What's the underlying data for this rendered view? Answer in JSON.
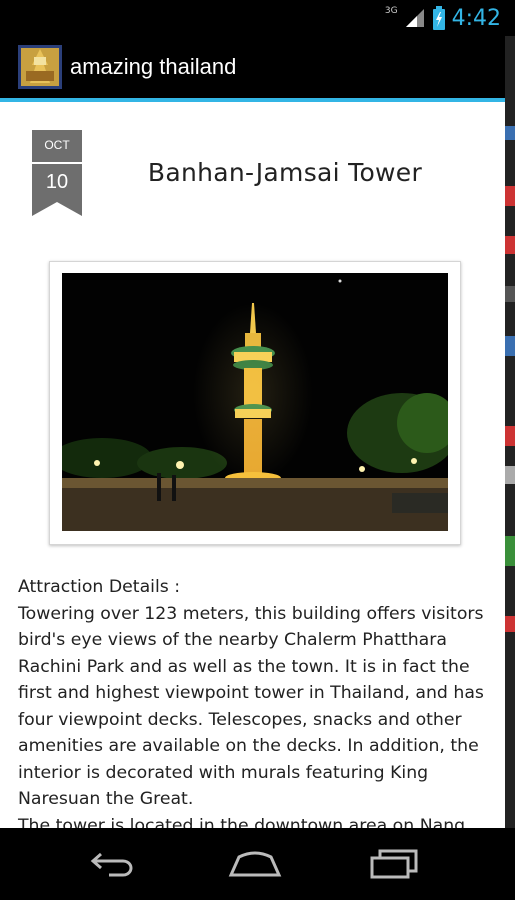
{
  "status_bar": {
    "network": "3G",
    "time": "4:42",
    "accent_color": "#33b5e5"
  },
  "action_bar": {
    "title": "amazing thailand",
    "icon": "app-logo-icon"
  },
  "attraction": {
    "date_month": "OCT",
    "date_day": "10",
    "title": "Banhan-Jamsai Tower",
    "photo_description_icon": "tower-night-photo",
    "details_heading": "Attraction Details :",
    "details_text": "Towering over 123 meters, this building offers visitors bird's eye views of the nearby Chalerm Phatthara Rachini Park and as well as the town. It is in fact the first and highest viewpoint tower in Thailand, and has four viewpoint decks. Telescopes, snacks and other amenities are available on the decks. In addition, the interior is decorated with murals featuring King Naresuan the Great.",
    "details_text_2": "The tower is located in the downtown area on Nang"
  },
  "nav_bar": {
    "back_icon": "back-icon",
    "home_icon": "home-icon",
    "recents_icon": "recent-apps-icon"
  }
}
